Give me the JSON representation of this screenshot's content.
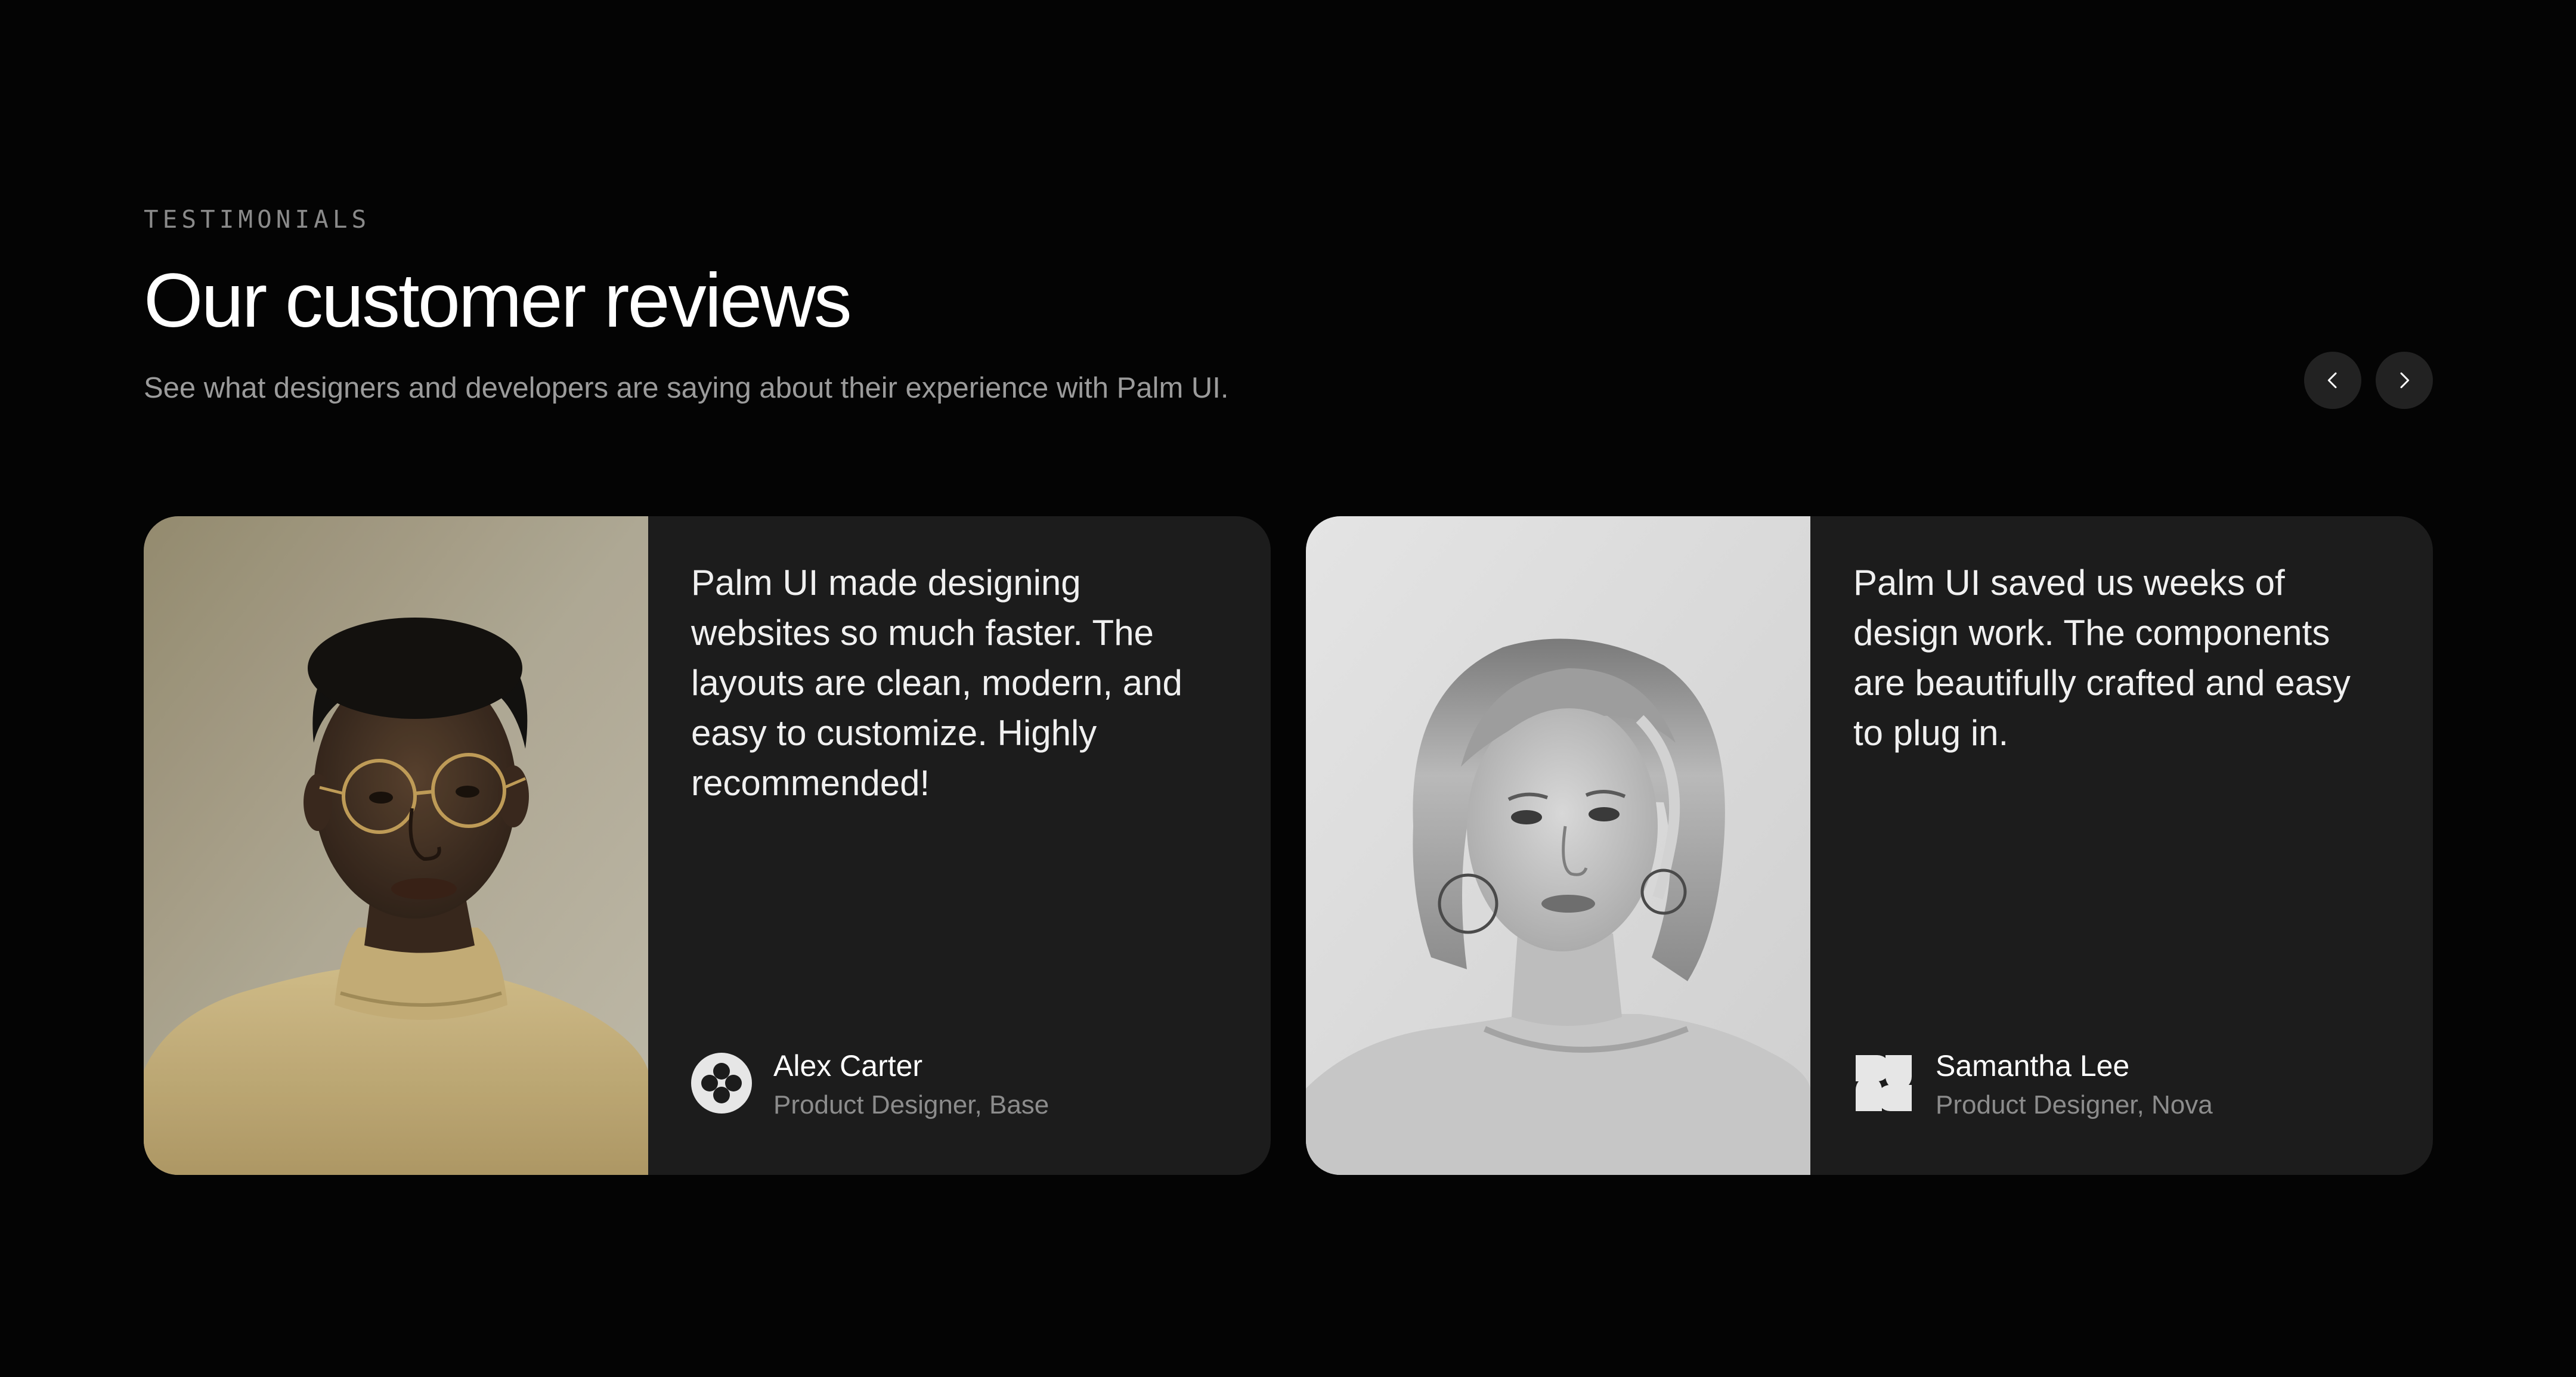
{
  "header": {
    "eyebrow": "TESTIMONIALS",
    "title": "Our customer reviews",
    "subtitle": "See what designers and developers are saying about their experience with Palm UI."
  },
  "carousel": {
    "prev_icon": "chevron-left-icon",
    "next_icon": "chevron-right-icon"
  },
  "testimonials": [
    {
      "quote": "Palm UI made designing websites so much faster. The layouts are clean, modern, and easy to customize. Highly recommended!",
      "name": "Alex Carter",
      "role": "Product Designer, Base",
      "logo_icon": "base-logo-icon",
      "photo": "portrait-man-glasses"
    },
    {
      "quote": "Palm UI saved us weeks of design work. The components are beautifully crafted and easy to plug in.",
      "name": "Samantha Lee",
      "role": "Product Designer, Nova",
      "logo_icon": "nova-logo-icon",
      "photo": "portrait-woman-bw"
    }
  ],
  "colors": {
    "background": "#040404",
    "card": "#1c1c1c",
    "muted_text": "#8c8c8c",
    "nav_button": "#222222"
  }
}
